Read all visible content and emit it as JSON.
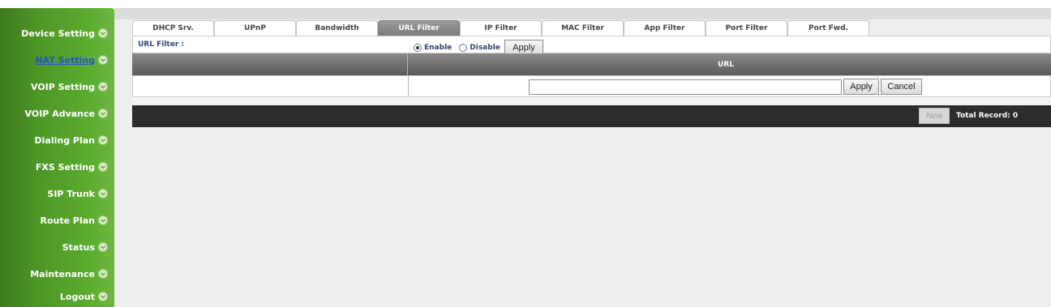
{
  "sidebar": {
    "items": [
      {
        "label": "Device Setting",
        "active": false
      },
      {
        "label": "NAT Setting",
        "active": true
      },
      {
        "label": "VOIP Setting",
        "active": false
      },
      {
        "label": "VOIP Advance",
        "active": false
      },
      {
        "label": "Dialing Plan",
        "active": false
      },
      {
        "label": "FXS Setting",
        "active": false
      },
      {
        "label": "SIP Trunk",
        "active": false
      },
      {
        "label": "Route Plan",
        "active": false
      },
      {
        "label": "Status",
        "active": false
      },
      {
        "label": "Maintenance",
        "active": false
      },
      {
        "label": "Logout",
        "active": false
      }
    ],
    "icon": "chevron-down-circle-icon",
    "color": "#4e9726"
  },
  "tabs": [
    {
      "label": "DHCP Srv.",
      "active": false
    },
    {
      "label": "UPnP",
      "active": false
    },
    {
      "label": "Bandwidth",
      "active": false
    },
    {
      "label": "URL Filter",
      "active": true
    },
    {
      "label": "IP Filter",
      "active": false
    },
    {
      "label": "MAC Filter",
      "active": false
    },
    {
      "label": "App Filter",
      "active": false
    },
    {
      "label": "Port Filter",
      "active": false
    },
    {
      "label": "Port Fwd.",
      "active": false
    }
  ],
  "filter": {
    "label": "URL Filter :",
    "enable_label": "Enable",
    "disable_label": "Disable",
    "selected": "Enable",
    "apply_label": "Apply"
  },
  "table": {
    "header_url": "URL",
    "url_value": "",
    "url_placeholder": "",
    "apply_label": "Apply",
    "cancel_label": "Cancel"
  },
  "footer": {
    "new_label": "New",
    "total_record": "Total Record: 0"
  },
  "colors": {
    "sidebar_green": "#4e9726",
    "active_link": "#2255cc",
    "header_gray": "#6e6e6e",
    "footer_dark": "#2c2c2c"
  }
}
